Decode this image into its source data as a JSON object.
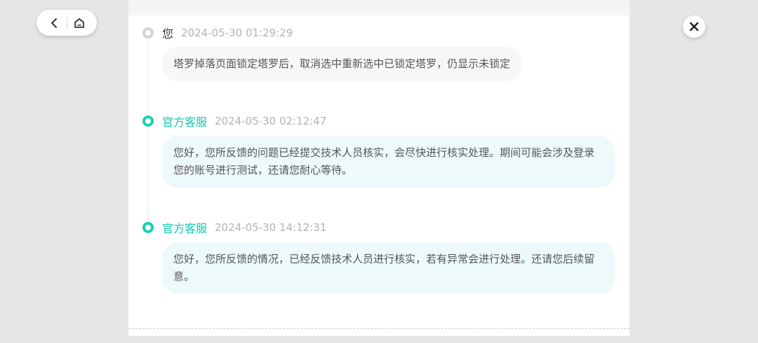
{
  "nav": {
    "back_icon": "chevron-left-icon",
    "home_icon": "home-icon",
    "close_icon": "close-icon"
  },
  "colors": {
    "accent": "#12c9b0",
    "user_dot": "#d3d3d3",
    "agent_bubble": "#edf9fa",
    "user_bubble": "#f7f7f7",
    "background": "#e6e6e6"
  },
  "messages": [
    {
      "sender": "您",
      "time": "2024-05-30 01:29:29",
      "text": "塔罗掉落页面锁定塔罗后，取消选中重新选中已锁定塔罗，仍显示未锁定"
    },
    {
      "sender": "官方客服",
      "time": "2024-05-30 02:12:47",
      "text": "您好，您所反馈的问题已经提交技术人员核实，会尽快进行核实处理。期间可能会涉及登录您的账号进行测试，还请您耐心等待。"
    },
    {
      "sender": "官方客服",
      "time": "2024-05-30 14:12:31",
      "text": "您好，您所反馈的情况，已经反馈技术人员进行核实，若有异常会进行处理。还请您后续留意。"
    }
  ]
}
